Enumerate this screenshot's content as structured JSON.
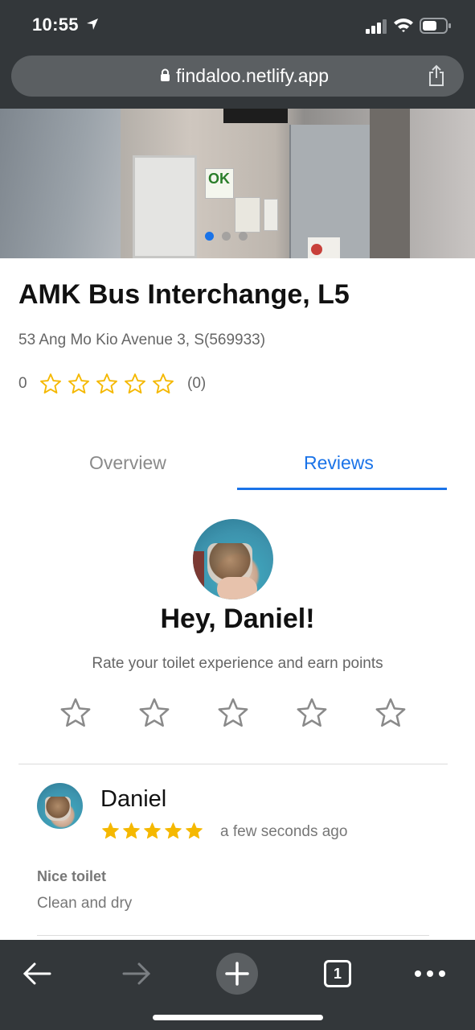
{
  "status_bar": {
    "time": "10:55"
  },
  "browser": {
    "url": "findaloo.netlify.app"
  },
  "hero": {
    "sign_text": "OK",
    "carousel_count": 3,
    "carousel_active": 1
  },
  "place": {
    "name": "AMK Bus Interchange, L5",
    "address": "53 Ang Mo Kio Avenue 3, S(569933)",
    "rating_value": "0",
    "rating_stars": 5,
    "rating_count": "(0)"
  },
  "tabs": [
    {
      "label": "Overview",
      "active": false
    },
    {
      "label": "Reviews",
      "active": true
    }
  ],
  "greeting": {
    "title": "Hey, Daniel!",
    "prompt": "Rate your toilet experience and earn points",
    "star_count": 5
  },
  "review": {
    "author": "Daniel",
    "rating": 5,
    "time": "a few seconds ago",
    "title": "Nice toilet",
    "body": "Clean and dry"
  },
  "toolbar": {
    "tab_count": "1"
  },
  "colors": {
    "accent": "#1a73e8",
    "star": "#f5b800",
    "chrome": "#33373a"
  }
}
